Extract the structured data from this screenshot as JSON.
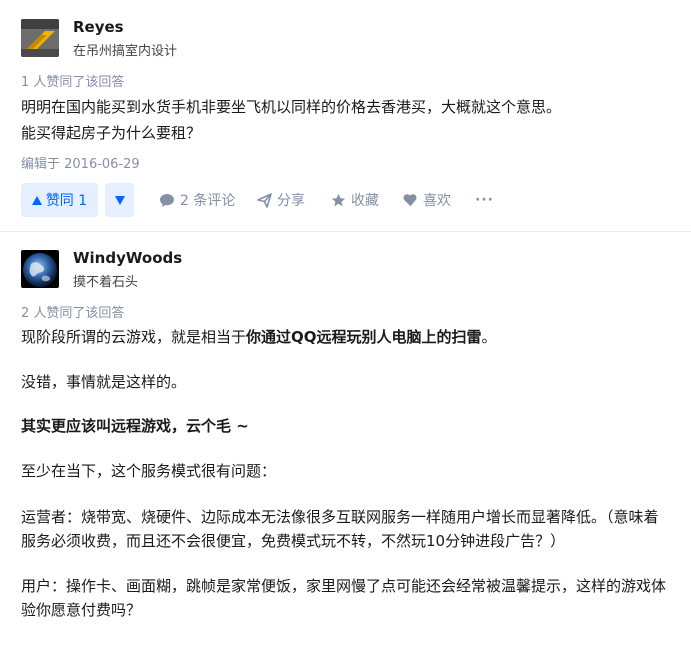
{
  "answers": [
    {
      "author": {
        "name": "Reyes",
        "bio": "在吊州搞室内设计"
      },
      "votes_line": "1 人赞同了该回答",
      "paragraphs": [
        "明明在国内能买到水货手机非要坐飞机以同样的价格去香港买，大概就这个意思。",
        "能买得起房子为什么要租？"
      ],
      "edited": "编辑于 2016-06-29",
      "actions": {
        "upvote_label": "赞同 1",
        "comments_label": "2 条评论",
        "share_label": "分享",
        "collect_label": "收藏",
        "like_label": "喜欢",
        "more_label": "···"
      }
    },
    {
      "author": {
        "name": "WindyWoods",
        "bio": "摸不着石头"
      },
      "votes_line": "2 人赞同了该回答",
      "paragraphs": {
        "p1_prefix": "现阶段所谓的云游戏，就是相当于",
        "p1_bold": "你通过QQ远程玩别人电脑上的扫雷",
        "p1_suffix": "。",
        "p2": "没错，事情就是这样的。",
        "p3": "其实更应该叫远程游戏，云个毛 ~",
        "p4": "至少在当下，这个服务模式很有问题：",
        "p5a": "运营者：烧带宽、烧硬件、边际成本无法像很多互联网服务一样随用户增长而显著降低。（意味着",
        "p5b": "服务必须收费，而且还不会很便宜，免费模式玩不转，不然玩10分钟进段广告？）",
        "p6a": "用户：操作卡、画面糊，跳帧是家常便饭，家里网慢了点可能还会经常被温馨提示，这样的游戏体",
        "p6b": "验你愿意付费吗？"
      }
    }
  ],
  "colors": {
    "accent": "#0066ff",
    "accent_bg": "#e5efff",
    "muted": "#8590a6"
  }
}
